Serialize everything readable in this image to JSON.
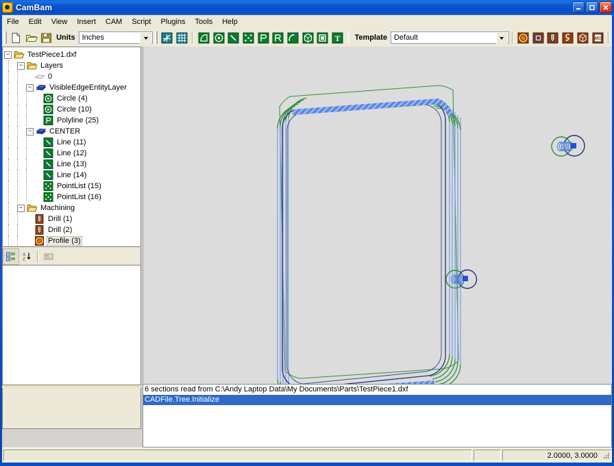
{
  "window": {
    "title": "CamBam",
    "app_icon": "cambam-logo-icon",
    "minimize_label": "Minimize",
    "maximize_label": "Maximize",
    "close_label": "Close"
  },
  "menubar": {
    "items": [
      {
        "label": "File"
      },
      {
        "label": "Edit"
      },
      {
        "label": "View"
      },
      {
        "label": "Insert"
      },
      {
        "label": "CAM"
      },
      {
        "label": "Script"
      },
      {
        "label": "Plugins"
      },
      {
        "label": "Tools"
      },
      {
        "label": "Help"
      }
    ]
  },
  "toolbar": {
    "new_label": "New",
    "open_label": "Open",
    "save_label": "Save",
    "units_label": "Units",
    "units_value": "Inches",
    "template_label": "Template",
    "template_value": "Default",
    "draw_icons": [
      {
        "name": "snap-to-grid-icon"
      },
      {
        "name": "show-grid-icon"
      }
    ],
    "shape_icons": [
      {
        "name": "polygon-icon"
      },
      {
        "name": "circle-icon"
      },
      {
        "name": "line-icon"
      },
      {
        "name": "pointlist-icon"
      },
      {
        "name": "polyline-icon"
      },
      {
        "name": "rectangle-icon"
      },
      {
        "name": "arc-icon"
      },
      {
        "name": "surface-icon"
      },
      {
        "name": "region-icon"
      },
      {
        "name": "text-icon"
      }
    ],
    "cam_icons": [
      {
        "name": "profile-operation-icon"
      },
      {
        "name": "pocket-operation-icon"
      },
      {
        "name": "drill-operation-icon"
      },
      {
        "name": "engrave-operation-icon"
      },
      {
        "name": "three-d-profile-operation-icon"
      },
      {
        "name": "post-process-icon"
      }
    ]
  },
  "tree": {
    "nodes": [
      {
        "label": "TestPiece1.dxf",
        "depth": 0,
        "expander": "minus",
        "icon": "folder-open-icon",
        "selected": false
      },
      {
        "label": "Layers",
        "depth": 1,
        "expander": "minus",
        "icon": "folder-open-icon",
        "selected": false
      },
      {
        "label": "0",
        "depth": 2,
        "expander": "none",
        "icon": "layer-gray-icon",
        "selected": false
      },
      {
        "label": "VisibleEdgeEntityLayer",
        "depth": 2,
        "expander": "minus",
        "icon": "layer-blue-icon",
        "selected": false
      },
      {
        "label": "Circle (4)",
        "depth": 3,
        "expander": "none",
        "icon": "circle-icon",
        "selected": false
      },
      {
        "label": "Circle (10)",
        "depth": 3,
        "expander": "none",
        "icon": "circle-icon",
        "selected": false
      },
      {
        "label": "Polyline (25)",
        "depth": 3,
        "expander": "none",
        "icon": "polyline-icon",
        "selected": false
      },
      {
        "label": "CENTER",
        "depth": 2,
        "expander": "minus",
        "icon": "layer-blue-icon",
        "selected": false
      },
      {
        "label": "Line (11)",
        "depth": 3,
        "expander": "none",
        "icon": "line-icon",
        "selected": false
      },
      {
        "label": "Line (12)",
        "depth": 3,
        "expander": "none",
        "icon": "line-icon",
        "selected": false
      },
      {
        "label": "Line (13)",
        "depth": 3,
        "expander": "none",
        "icon": "line-icon",
        "selected": false
      },
      {
        "label": "Line (14)",
        "depth": 3,
        "expander": "none",
        "icon": "line-icon",
        "selected": false
      },
      {
        "label": "PointList (15)",
        "depth": 3,
        "expander": "none",
        "icon": "pointlist-icon",
        "selected": false
      },
      {
        "label": "PointList (16)",
        "depth": 3,
        "expander": "none",
        "icon": "pointlist-icon",
        "selected": false
      },
      {
        "label": "Machining",
        "depth": 1,
        "expander": "minus",
        "icon": "folder-open-icon",
        "selected": false
      },
      {
        "label": "Drill (1)",
        "depth": 2,
        "expander": "none",
        "icon": "drill-op-icon",
        "selected": false
      },
      {
        "label": "Drill (2)",
        "depth": 2,
        "expander": "none",
        "icon": "drill-op-icon",
        "selected": false
      },
      {
        "label": "Profile (3)",
        "depth": 2,
        "expander": "none",
        "icon": "profile-op-icon",
        "selected": true
      }
    ]
  },
  "property_toolbar": {
    "categorized_label": "Categorized",
    "alphabetical_label": "Alphabetical",
    "property_pages_label": "Property Pages",
    "icons": [
      {
        "name": "categorized-view-icon"
      },
      {
        "name": "alphabetical-sort-icon"
      },
      {
        "name": "property-pages-icon"
      }
    ]
  },
  "log": {
    "lines": [
      {
        "text": "6 sections read from C:\\Andy Laptop Data\\My Documents\\Parts\\TestPiece1.dxf",
        "selected": false
      },
      {
        "text": "CADFile.Tree.Initialize",
        "selected": true
      }
    ]
  },
  "statusbar": {
    "message": "",
    "middle": "",
    "coordinates": "2.0000, 3.0000"
  },
  "drawing": {
    "description": "Rounded rectangle part with two drill holes shown in 3D isometric view",
    "background_color": "#dcdcdc",
    "geometry_color": "#20307a",
    "toolpath_color": "#2f7d32",
    "rapid_color": "#6a93e0",
    "cut_color": "#4a7fe0"
  }
}
